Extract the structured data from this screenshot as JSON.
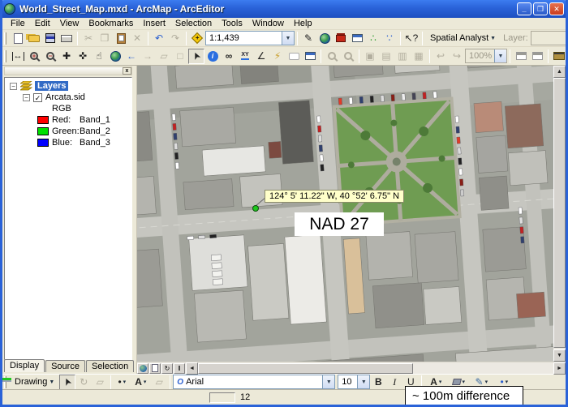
{
  "window": {
    "title": "World_Street_Map.mxd - ArcMap - ArcEditor"
  },
  "menu": {
    "items": [
      "File",
      "Edit",
      "View",
      "Bookmarks",
      "Insert",
      "Selection",
      "Tools",
      "Window",
      "Help"
    ]
  },
  "standard_toolbar": {
    "scale": "1:1,439",
    "spatial_analyst": "Spatial Analyst",
    "layer_label": "Layer:"
  },
  "tools_toolbar": {
    "zoom": "100%"
  },
  "toc": {
    "root": "Layers",
    "layer": "Arcata.sid",
    "renderer": "RGB",
    "bands": [
      {
        "channel": "Red:",
        "band": "Band_1",
        "color": "#ff0000"
      },
      {
        "channel": "Green:",
        "band": "Band_2",
        "color": "#00e000"
      },
      {
        "channel": "Blue:",
        "band": "Band_3",
        "color": "#0000ff"
      }
    ],
    "tabs": [
      "Display",
      "Source",
      "Selection"
    ]
  },
  "map": {
    "tooltip": "124° 5' 11.22\" W, 40 °52' 6.75\" N",
    "datum_label": "NAD 27",
    "annotation": "~ 100m difference"
  },
  "drawing": {
    "menu": "Drawing",
    "font": "Arial",
    "size": "10"
  },
  "status": {
    "coords": "12"
  },
  "colors": {
    "selection_blue": "#316ac5",
    "tooltip_yellow": "#ffffca",
    "titlebar_blue": "#2a62d8"
  },
  "icons": {
    "minimize": "_",
    "restore": "❐",
    "close": "✕",
    "close_sm": "x",
    "caret": "▼",
    "caret_sm": "▾",
    "up": "▲",
    "down": "▼",
    "left": "◄",
    "right": "►",
    "scissors": "✂",
    "copy": "❐",
    "delete": "✕",
    "undo": "↶",
    "redo": "↷",
    "plus": "+",
    "minus": "−",
    "extent_arrows": "↔",
    "fixed_zoom_in": "✚",
    "fixed_zoom_out": "✜",
    "pan": "☝",
    "back": "←",
    "forward": "→",
    "select_features": "▱",
    "clear_selection": "□",
    "pointer": "➤",
    "identify": "i",
    "find": "∞",
    "goto_xy": "XY",
    "measure": "∠",
    "hyperlink": "⚡",
    "whats_this": "↖?",
    "nodes": "∴",
    "model": "∵",
    "pencil": "✎",
    "hatch": "▩",
    "wedge": "◣",
    "layout1": "▣",
    "layout2": "▤",
    "layout3": "▥",
    "layout4": "▦",
    "pg_back": "↩",
    "pg_fwd": "↪",
    "refresh": "↻",
    "pause": "‖",
    "bold": "B",
    "italic": "I",
    "underline": "U",
    "text_tool": "A",
    "font_color": "A",
    "font_badge": "O",
    "marker_dot": "•",
    "rotate": "↻",
    "poly": "▱",
    "expand": "−",
    "check": "✓"
  }
}
